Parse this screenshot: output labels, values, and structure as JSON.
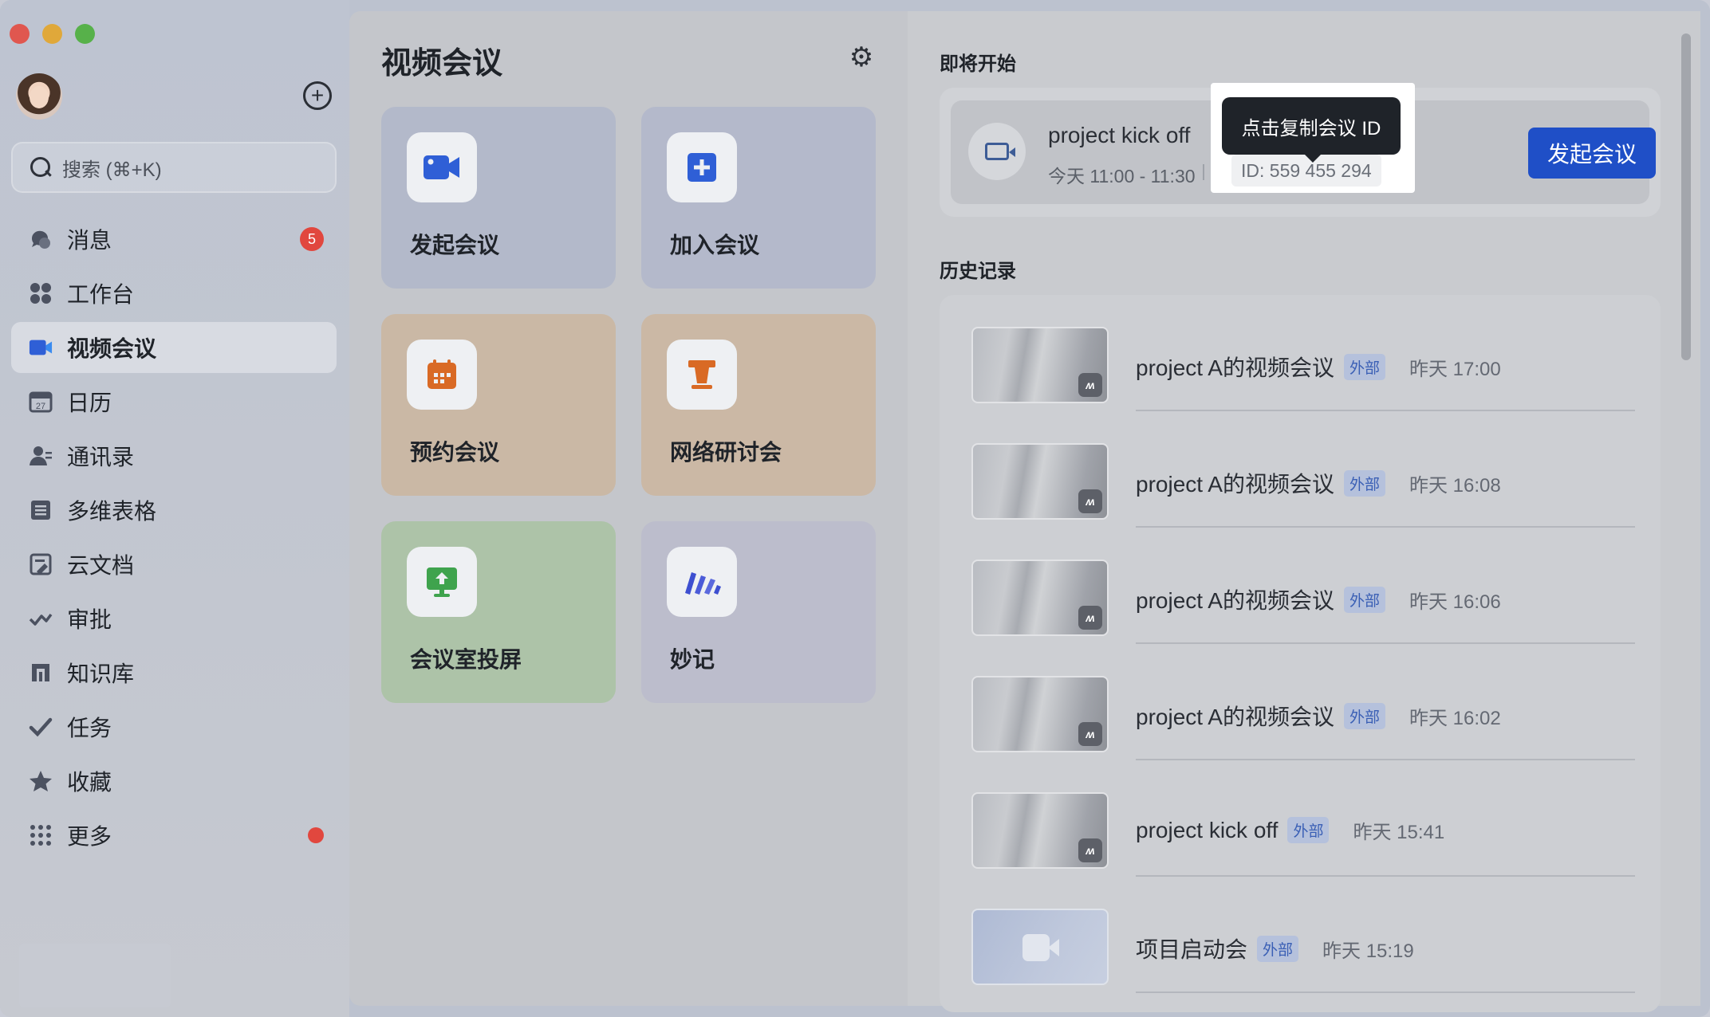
{
  "sidebar": {
    "search_placeholder": "搜索 (⌘+K)",
    "items": [
      {
        "label": "消息",
        "icon": "chat-icon",
        "badge": "5"
      },
      {
        "label": "工作台",
        "icon": "grid-icon"
      },
      {
        "label": "视频会议",
        "icon": "video-icon",
        "active": true
      },
      {
        "label": "日历",
        "icon": "calendar-icon",
        "icon_text": "27"
      },
      {
        "label": "通讯录",
        "icon": "contacts-icon"
      },
      {
        "label": "多维表格",
        "icon": "table-icon"
      },
      {
        "label": "云文档",
        "icon": "doc-icon"
      },
      {
        "label": "审批",
        "icon": "approval-icon"
      },
      {
        "label": "知识库",
        "icon": "wiki-icon"
      },
      {
        "label": "任务",
        "icon": "task-check-icon"
      },
      {
        "label": "收藏",
        "icon": "star-icon"
      },
      {
        "label": "更多",
        "icon": "more-dots-icon",
        "dot": true
      }
    ]
  },
  "middle": {
    "title": "视频会议",
    "tiles": [
      {
        "label": "发起会议",
        "icon": "video-camera-icon"
      },
      {
        "label": "加入会议",
        "icon": "plus-square-icon"
      },
      {
        "label": "预约会议",
        "icon": "calendar-icon"
      },
      {
        "label": "网络研讨会",
        "icon": "podium-icon"
      },
      {
        "label": "会议室投屏",
        "icon": "screen-share-icon"
      },
      {
        "label": "妙记",
        "icon": "minutes-icon"
      }
    ]
  },
  "right": {
    "upcoming_title": "即将开始",
    "upcoming": {
      "title": "project kick off",
      "time": "今天 11:00 - 11:30",
      "id_text": "ID: 559 455 294",
      "tooltip": "点击复制会议 ID",
      "start_button": "发起会议"
    },
    "history_title": "历史记录",
    "history": [
      {
        "title": "project A的视频会议",
        "tag": "外部",
        "time": "昨天 17:00"
      },
      {
        "title": "project A的视频会议",
        "tag": "外部",
        "time": "昨天 16:08"
      },
      {
        "title": "project A的视频会议",
        "tag": "外部",
        "time": "昨天 16:06"
      },
      {
        "title": "project A的视频会议",
        "tag": "外部",
        "time": "昨天 16:02"
      },
      {
        "title": "project kick off",
        "tag": "外部",
        "time": "昨天 15:41"
      },
      {
        "title": "项目启动会",
        "tag": "外部",
        "time": "昨天 15:19",
        "no_recording": true
      }
    ]
  },
  "colors": {
    "accent": "#1f4fc7",
    "badge": "#e1473e",
    "tag_text": "#3a5fb5"
  }
}
